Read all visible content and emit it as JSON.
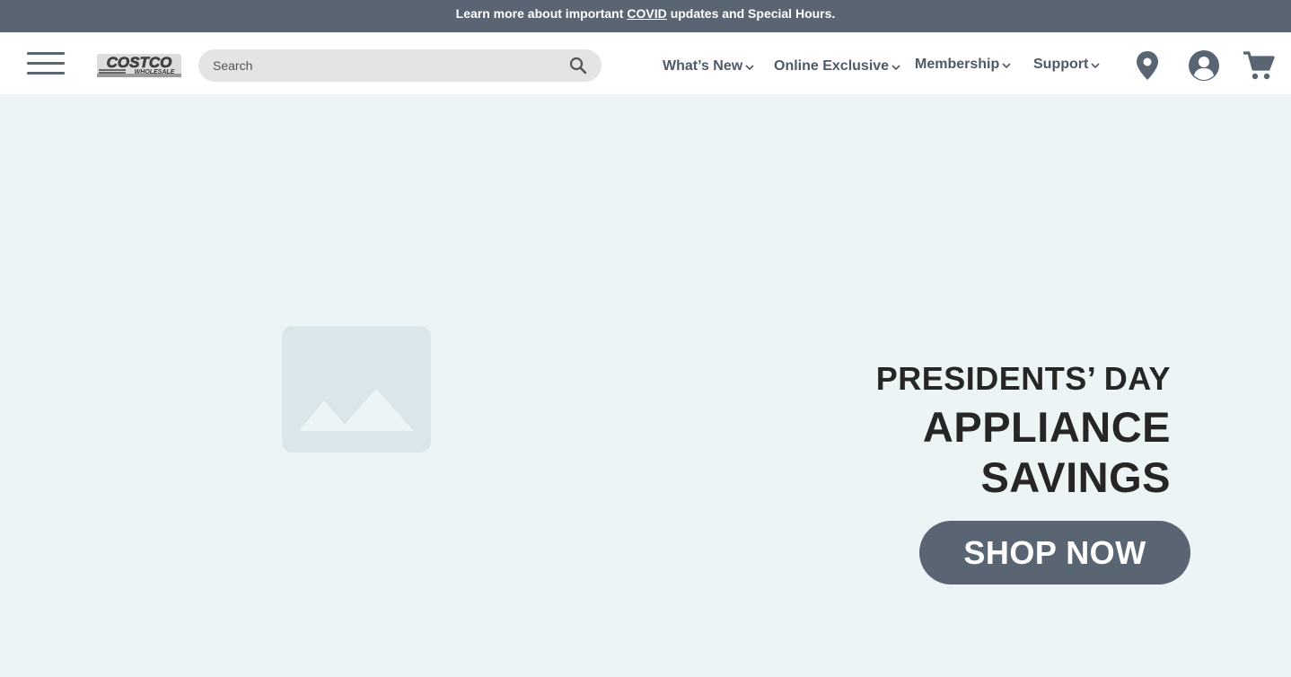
{
  "announcement": {
    "prefix": "Learn more about important",
    "link": "COVID",
    "suffix": "updates and Special Hours."
  },
  "header": {
    "logo_text": "COSTCO",
    "logo_subtext": "WHOLESALE",
    "search_placeholder": "Search",
    "nav": [
      {
        "label": "What’s New"
      },
      {
        "label": "Online Exclusive"
      },
      {
        "label": "Membership"
      },
      {
        "label": "Support"
      }
    ]
  },
  "hero": {
    "line1": "PRESIDENTS’ DAY",
    "line2": "APPLIANCE",
    "line3": "SAVINGS",
    "cta": "SHOP NOW"
  },
  "icons": {
    "menu": "hamburger-menu-icon",
    "search": "search-icon",
    "location": "location-pin-icon",
    "account": "account-icon",
    "cart": "cart-icon",
    "image": "image-placeholder-icon"
  },
  "colors": {
    "primary": "#5a6574",
    "background": "#edf4f6",
    "text_dark": "#262626",
    "nav_text": "#4f5967"
  }
}
